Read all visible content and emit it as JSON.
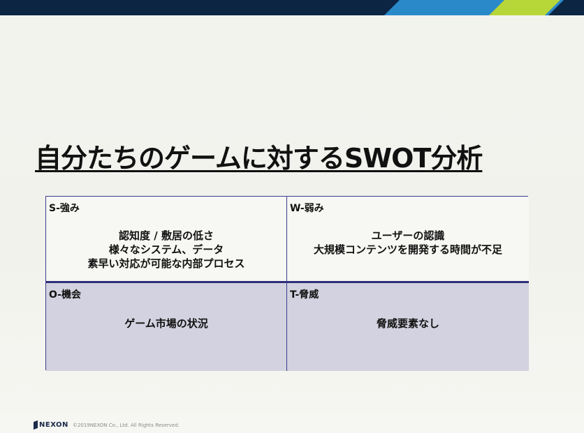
{
  "slide": {
    "title": "自分たちのゲームに対するSWOT分析"
  },
  "swot": {
    "strengths": {
      "label": "S-強み",
      "lines": [
        "認知度 / 敷居の低さ",
        "様々なシステム、データ",
        "素早い対応が可能な内部プロセス"
      ]
    },
    "weaknesses": {
      "label": "W-弱み",
      "lines": [
        "ユーザーの認識",
        "大規模コンテンツを開発する時間が不足"
      ]
    },
    "opportunities": {
      "label": "O-機会",
      "lines": [
        "ゲーム市場の状況"
      ]
    },
    "threats": {
      "label": "T-脅威",
      "lines": [
        "脅威要素なし"
      ]
    }
  },
  "footer": {
    "logo_text": "NEXON",
    "copyright": "©2019NEXON Co., Ltd. All Rights Reserved."
  },
  "colors": {
    "top_bar": "#0c2543",
    "accent_blue": "#2a89c9",
    "accent_green": "#b7d638",
    "grid_border": "#3b3b8e",
    "bottom_row_fill": "#d2d2e0"
  }
}
